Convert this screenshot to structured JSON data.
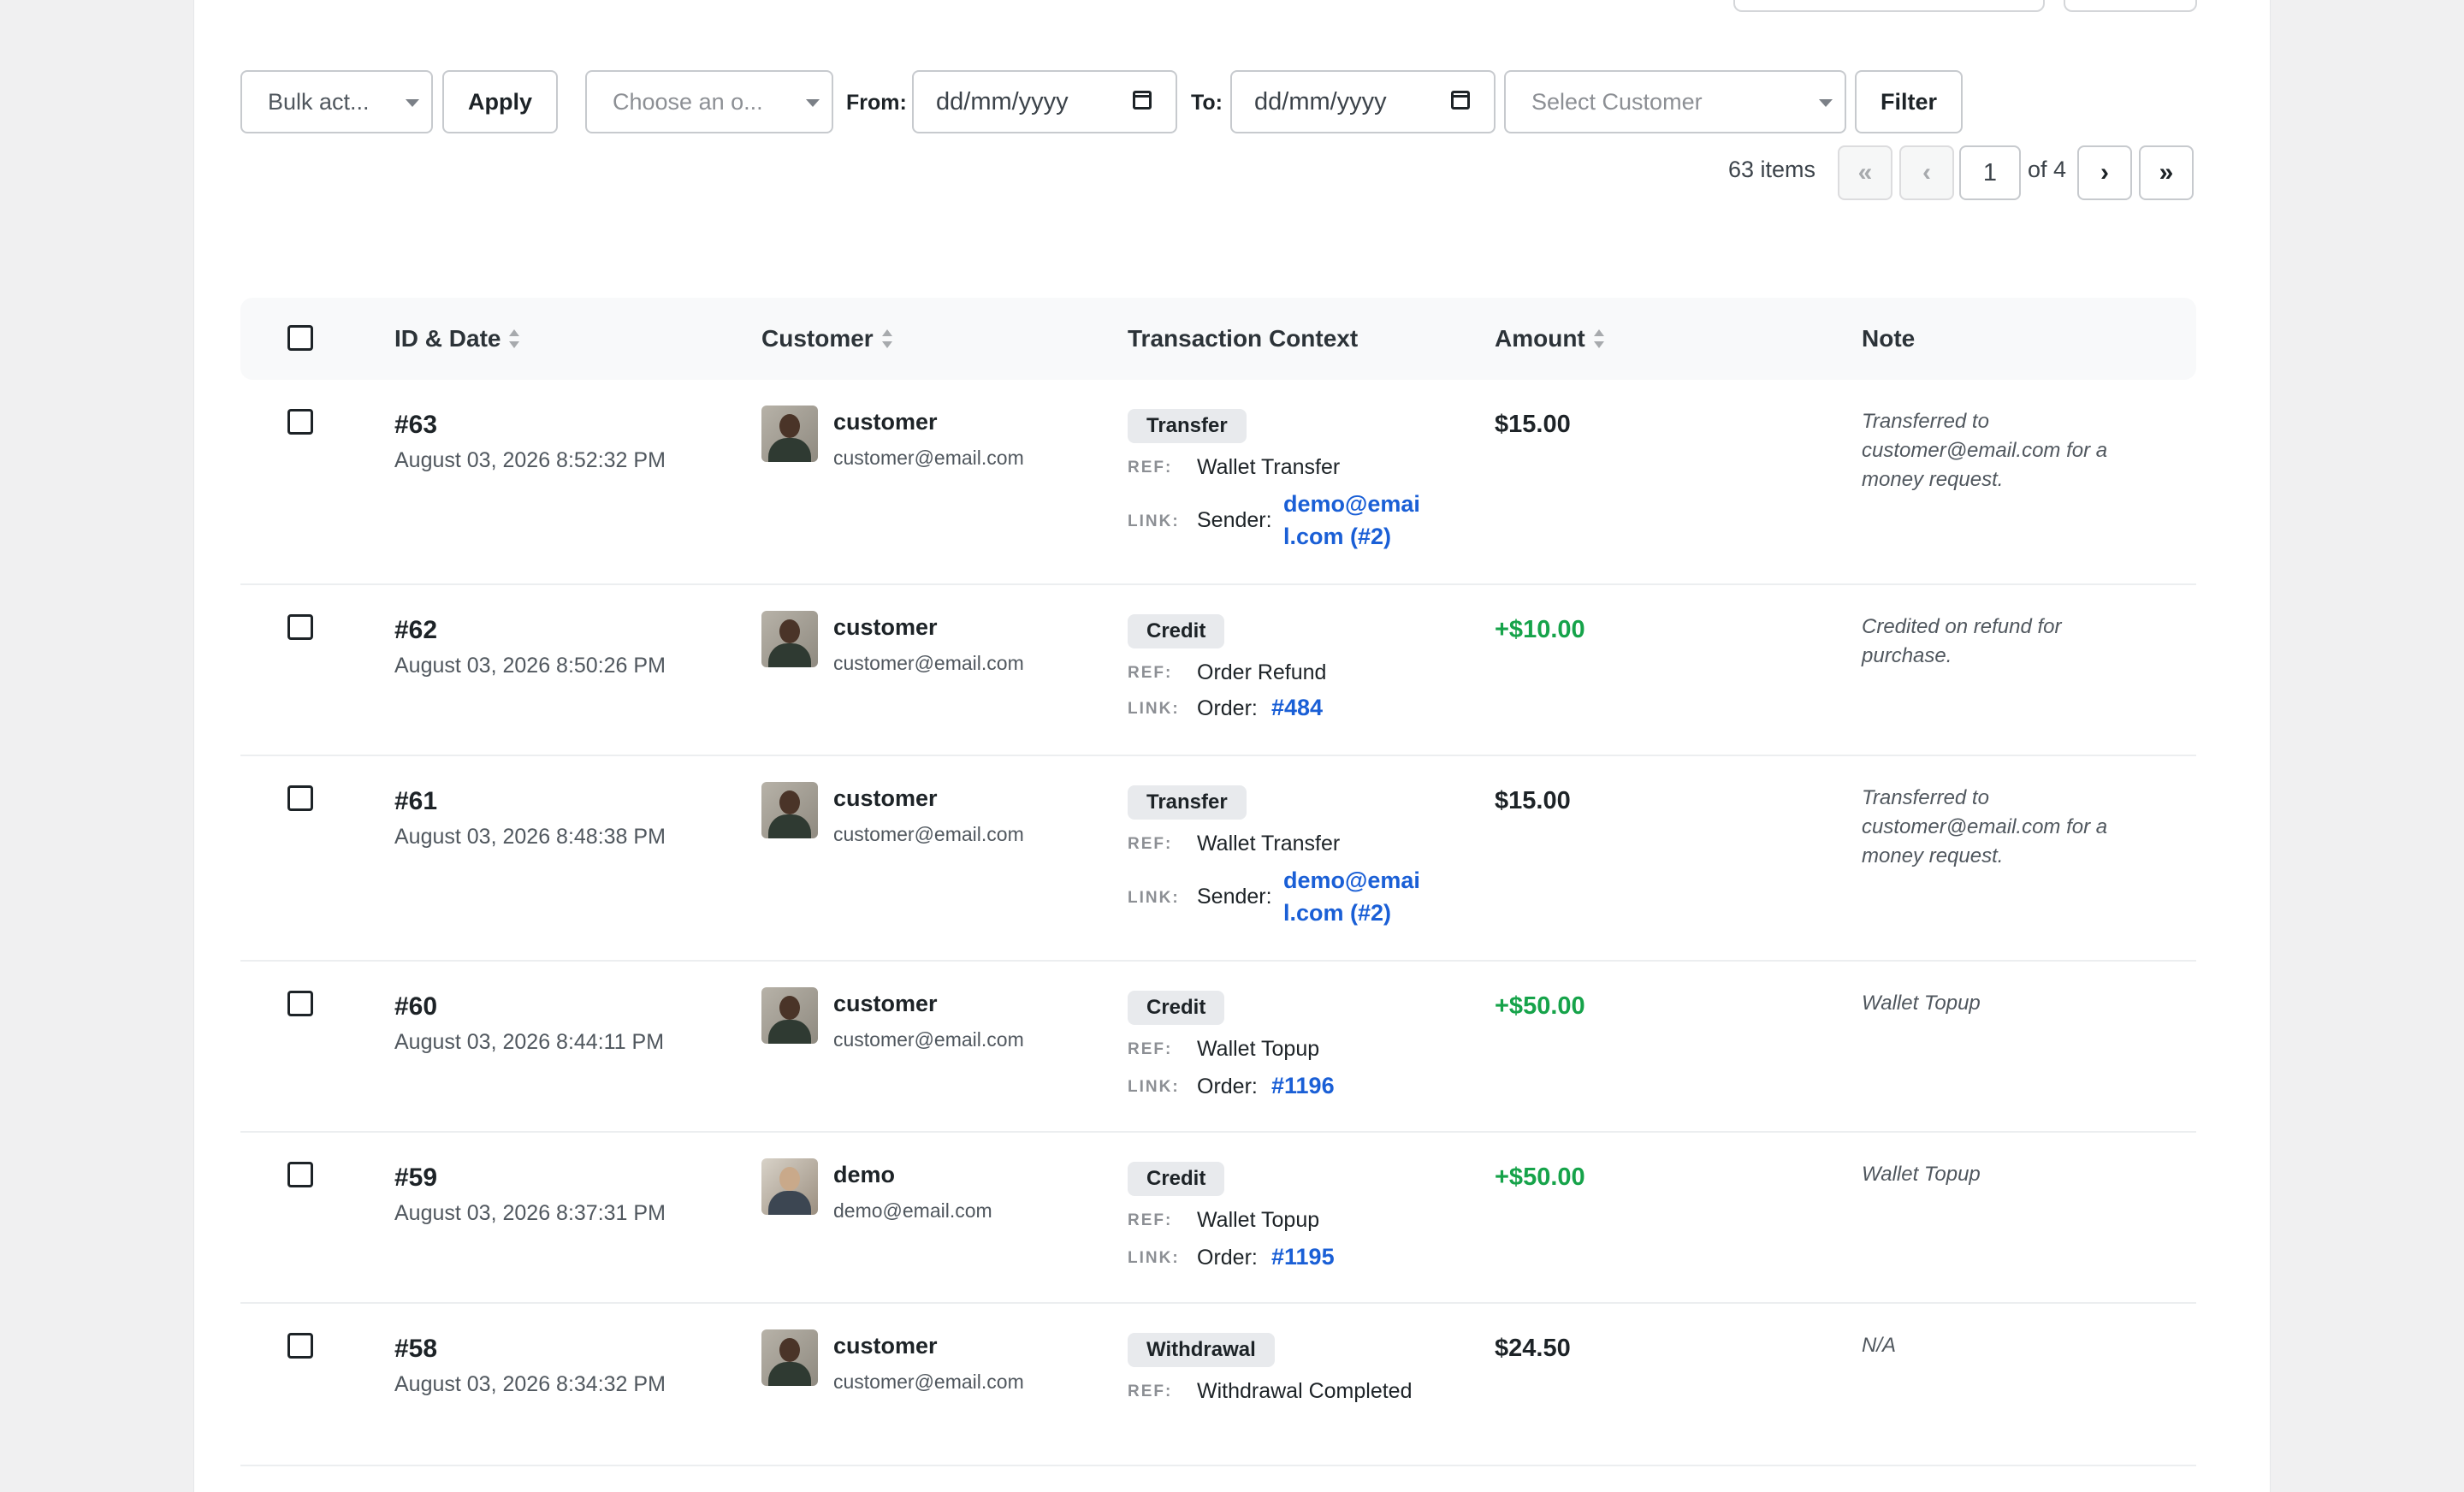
{
  "toolbar": {
    "bulk_action": "Bulk act...",
    "apply": "Apply",
    "type_filter": "Choose an o...",
    "from_label": "From:",
    "from_placeholder": "dd/mm/yyyy",
    "to_label": "To:",
    "to_placeholder": "dd/mm/yyyy",
    "customer_placeholder": "Select Customer",
    "filter": "Filter"
  },
  "pagination": {
    "count": "63 items",
    "first": "«",
    "prev": "‹",
    "current": "1",
    "of": "of 4",
    "next": "›",
    "last": "»"
  },
  "table": {
    "headers": {
      "id_date": "ID & Date",
      "customer": "Customer",
      "context": "Transaction Context",
      "amount": "Amount",
      "note": "Note"
    },
    "ref_label": "REF:",
    "link_label": "LINK:",
    "rows": [
      {
        "id": "#63",
        "date": "August 03, 2026 8:52:32 PM",
        "name": "customer",
        "email": "customer@email.com",
        "type": "Transfer",
        "ref": "Wallet Transfer",
        "link_prefix": "Sender:",
        "link_line1": "demo@emai",
        "link_line2": "l.com (#2)",
        "amount": "$15.00",
        "note": "Transferred to customer@email.com for a money request."
      },
      {
        "id": "#62",
        "date": "August 03, 2026 8:50:26 PM",
        "name": "customer",
        "email": "customer@email.com",
        "type": "Credit",
        "ref": "Order Refund",
        "link_prefix": "Order:",
        "link_text": "#484",
        "amount": "+$10.00",
        "note": "Credited on refund for purchase."
      },
      {
        "id": "#61",
        "date": "August 03, 2026 8:48:38 PM",
        "name": "customer",
        "email": "customer@email.com",
        "type": "Transfer",
        "ref": "Wallet Transfer",
        "link_prefix": "Sender:",
        "link_line1": "demo@emai",
        "link_line2": "l.com (#2)",
        "amount": "$15.00",
        "note": "Transferred to customer@email.com for a money request."
      },
      {
        "id": "#60",
        "date": "August 03, 2026 8:44:11 PM",
        "name": "customer",
        "email": "customer@email.com",
        "type": "Credit",
        "ref": "Wallet Topup",
        "link_prefix": "Order:",
        "link_text": "#1196",
        "amount": "+$50.00",
        "note": "Wallet Topup"
      },
      {
        "id": "#59",
        "date": "August 03, 2026 8:37:31 PM",
        "name": "demo",
        "email": "demo@email.com",
        "type": "Credit",
        "ref": "Wallet Topup",
        "link_prefix": "Order:",
        "link_text": "#1195",
        "amount": "+$50.00",
        "note": "Wallet Topup"
      },
      {
        "id": "#58",
        "date": "August 03, 2026 8:34:32 PM",
        "name": "customer",
        "email": "customer@email.com",
        "type": "Withdrawal",
        "ref": "Withdrawal Completed",
        "amount": "$24.50",
        "note": "N/A"
      }
    ]
  },
  "colors": {
    "positive_amount": "#16a34a",
    "link": "#1a5fd6"
  }
}
